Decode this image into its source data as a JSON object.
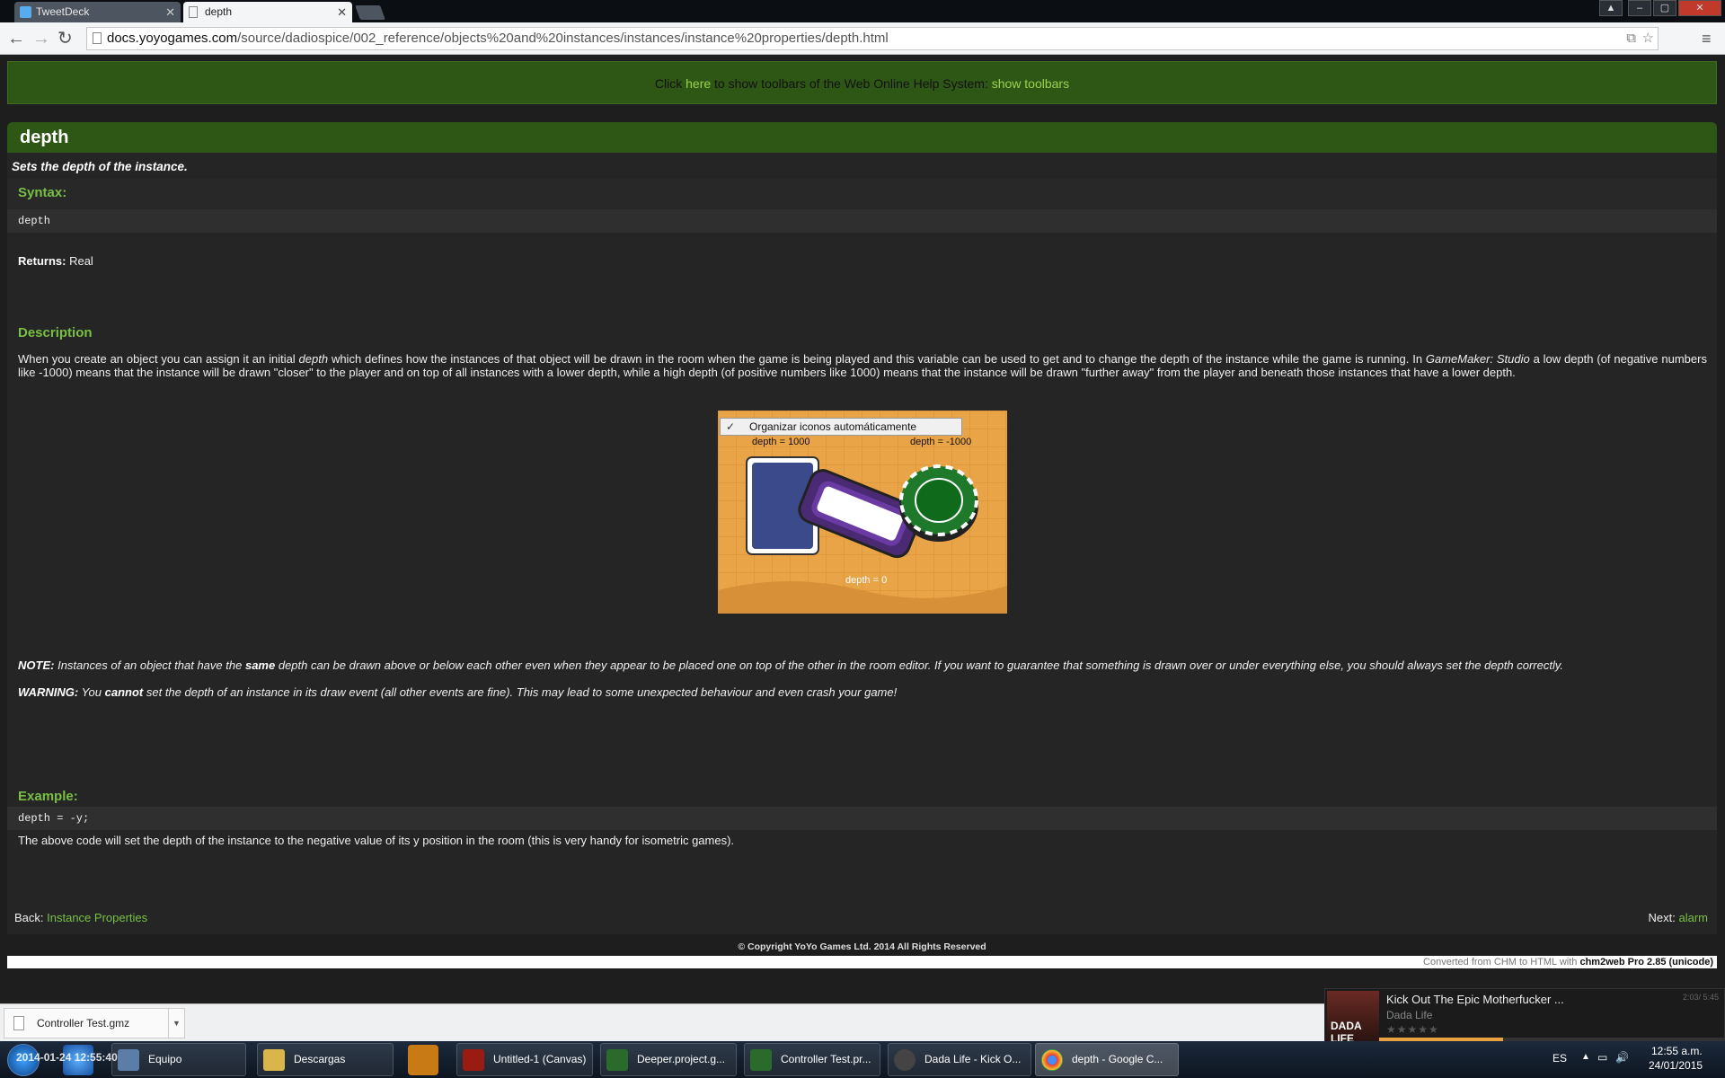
{
  "browser": {
    "tabs": [
      {
        "label": "TweetDeck"
      },
      {
        "label": "depth"
      }
    ],
    "url": {
      "host": "docs.yoyogames.com",
      "path": "/source/dadiospice/002_reference/objects%20and%20instances/instances/instance%20properties/depth.html"
    }
  },
  "helpbar": {
    "prefix": "Click",
    "here": "here",
    "middle": "to show toolbars of the Web Online Help System:",
    "show": "show toolbars"
  },
  "doc": {
    "title": "depth",
    "summary": "Sets the depth of the instance.",
    "syntax_heading": "Syntax:",
    "syntax_code": "depth",
    "returns_label": "Returns:",
    "returns_value": "Real",
    "description_heading": "Description",
    "desc_p1": "When you create an object you can assign it an initial",
    "desc_em": "depth",
    "desc_p2": "which defines how the instances of that object will be drawn in the room when the game is being played and this variable can be used to get and to change the depth of the instance while the game is running. In",
    "desc_em2": "GameMaker: Studio",
    "desc_p3": "a low depth (of negative numbers like -1000) means that the instance will be drawn \"closer\" to the player and on top of all instances with a lower depth, while a high depth (of positive numbers like 1000) means that the instance will be drawn \"further away\" from the player and beneath those instances that have a lower depth.",
    "figure": {
      "context_menu": "Organizar iconos automáticamente",
      "label_left": "depth = 1000",
      "label_right": "depth = -1000",
      "label_bottom": "depth = 0"
    },
    "note_label": "NOTE:",
    "note_a": "Instances of an object that have the",
    "note_b": "same",
    "note_c": "depth can be drawn above or below each other even when they appear to be placed one on top of the other in the room editor. If you want to guarantee that something is drawn over or under everything else, you should always set the depth correctly.",
    "warn_label": "WARNING:",
    "warn_a": "You",
    "warn_b": "cannot",
    "warn_c": "set the depth of an instance in its draw event (all other events are fine). This may lead to some unexpected behaviour and even crash your game!",
    "example_heading": "Example:",
    "example_code": "depth = -y;",
    "example_text": "The above code will set the depth of the instance to the negative value of its y position in the room (this is very handy for isometric games).",
    "back_label": "Back:",
    "back_link": "Instance Properties",
    "next_label": "Next:",
    "next_link": "alarm",
    "copyright": "© Copyright YoYo Games Ltd. 2014 All Rights Reserved",
    "converted_prefix": "Converted from CHM to HTML with",
    "converted_tool": "chm2web Pro 2.85 (unicode)"
  },
  "downloads": {
    "file": "Controller Test.gmz"
  },
  "toast": {
    "title": "Kick Out The Epic Motherfucker ...",
    "artist": "Dada Life",
    "time": "2:03/ 5:45",
    "art_text": "DADA LIFE",
    "progress": 0.36
  },
  "taskbar": {
    "overlay": "2014-01-24 12:55:40",
    "items": [
      {
        "label": "Equipo"
      },
      {
        "label": "Descargas"
      },
      {
        "label": "Untitled-1 (Canvas)"
      },
      {
        "label": "Deeper.project.g..."
      },
      {
        "label": "Controller Test.pr..."
      },
      {
        "label": "Dada Life - Kick O..."
      },
      {
        "label": "depth - Google C..."
      }
    ],
    "lang": "ES",
    "time": "12:55 a.m.",
    "date": "24/01/2015"
  }
}
